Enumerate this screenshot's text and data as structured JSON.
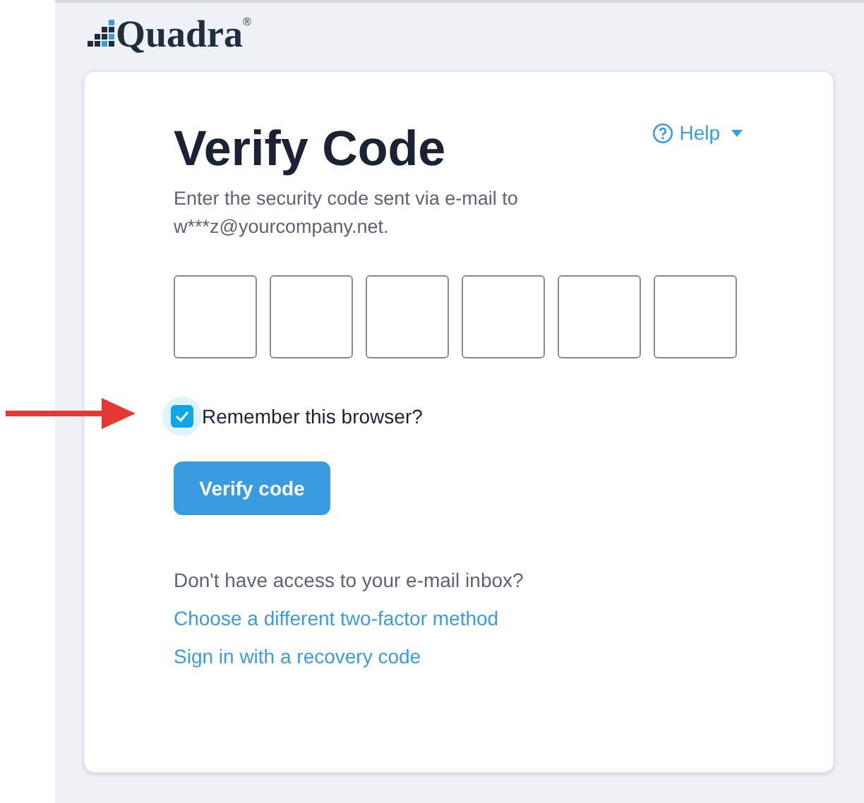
{
  "logo": {
    "name": "Quadra",
    "mark": "®"
  },
  "help": {
    "label": "Help"
  },
  "title": "Verify Code",
  "instructions": "Enter the security code sent via e-mail to w***z@yourcompany.net.",
  "remember": {
    "label": "Remember this browser?",
    "checked": true
  },
  "submit": {
    "label": "Verify code"
  },
  "alternatives": {
    "prompt": "Don't have access to your e-mail inbox?",
    "links": [
      "Choose a different two-factor method",
      "Sign in with a recovery code"
    ]
  }
}
